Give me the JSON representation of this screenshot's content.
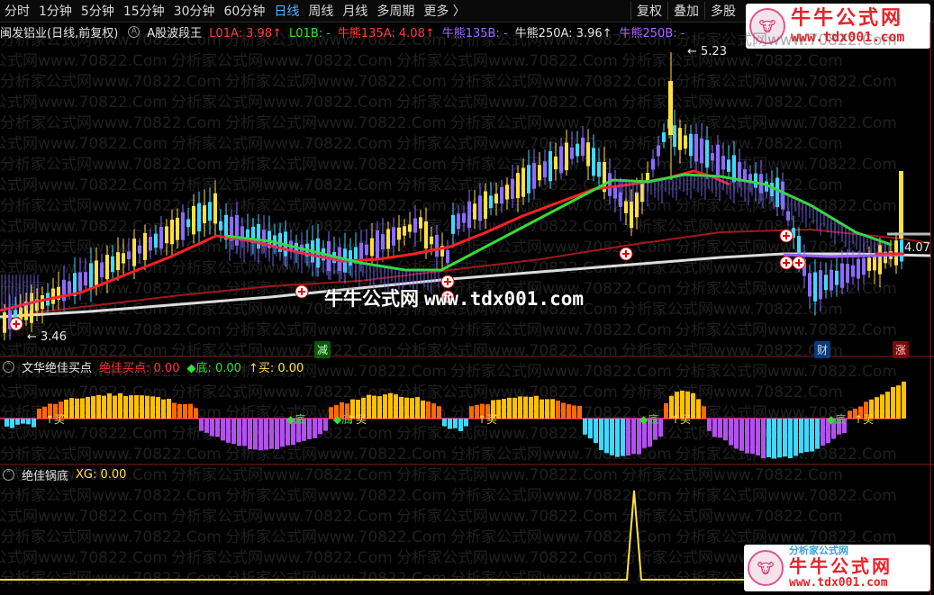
{
  "toolbar": {
    "periods": [
      "分时",
      "1分钟",
      "5分钟",
      "15分钟",
      "30分钟",
      "60分钟",
      "日线",
      "周线",
      "月线",
      "多周期",
      "更多 〉"
    ],
    "active_index": 6,
    "right_buttons": [
      "复权",
      "叠加",
      "多股"
    ]
  },
  "logo": {
    "title": "牛牛公式网",
    "url": "www.tdx001.com",
    "icon": "cow-icon"
  },
  "logo2": {
    "partner": "分析家公式网",
    "title": "牛牛公式网",
    "url": "www.tdx001.com"
  },
  "main_legend": {
    "stock": "闽发铝业(日线,前复权)",
    "indicator": "A股波段王",
    "items": [
      {
        "text": "L01A: 3.98↑",
        "color": "#ff3b3b"
      },
      {
        "text": "L01B: -",
        "color": "#33e033"
      },
      {
        "text": "牛熊135A: 4.08↑",
        "color": "#ff3b3b"
      },
      {
        "text": "牛熊135B: -",
        "color": "#9a6cff"
      },
      {
        "text": "牛熊250A: 3.96↑",
        "color": "#e6e6e6"
      },
      {
        "text": "牛熊250B: -",
        "color": "#b266ff"
      }
    ]
  },
  "price_labels": {
    "high": "5.23",
    "low": "3.46",
    "last": "4.07"
  },
  "markers": {
    "jian": "减",
    "cai": "财",
    "zhang": "涨"
  },
  "panel2_legend": {
    "name": "文华绝佳买点",
    "items": [
      {
        "text": "绝佳买点: 0.00",
        "color": "#ff3030"
      },
      {
        "text": "◆底: 0.00",
        "color": "#33e033"
      },
      {
        "text": "↑买: 0.00",
        "color": "#ffe040"
      }
    ]
  },
  "panel2_tags": {
    "buy": "↑买",
    "bottom": "◆底"
  },
  "panel3_legend": {
    "name": "绝佳锅底",
    "items": [
      {
        "text": "XG: 0.00",
        "color": "#ffe040"
      }
    ]
  },
  "watermark": {
    "text": "分析家公式网www.70822.Com"
  },
  "center_watermark": {
    "title": "牛牛公式网",
    "url": "www.tdx001.com"
  },
  "colors": {
    "up": "#ffe040",
    "down_cyan": "#40d8ff",
    "down_purple": "#8a6cff",
    "ma_red": "#ff2020",
    "ma_green": "#33e033",
    "ma_dark_red": "#a01818",
    "ma_white": "#dcdcdc"
  }
}
